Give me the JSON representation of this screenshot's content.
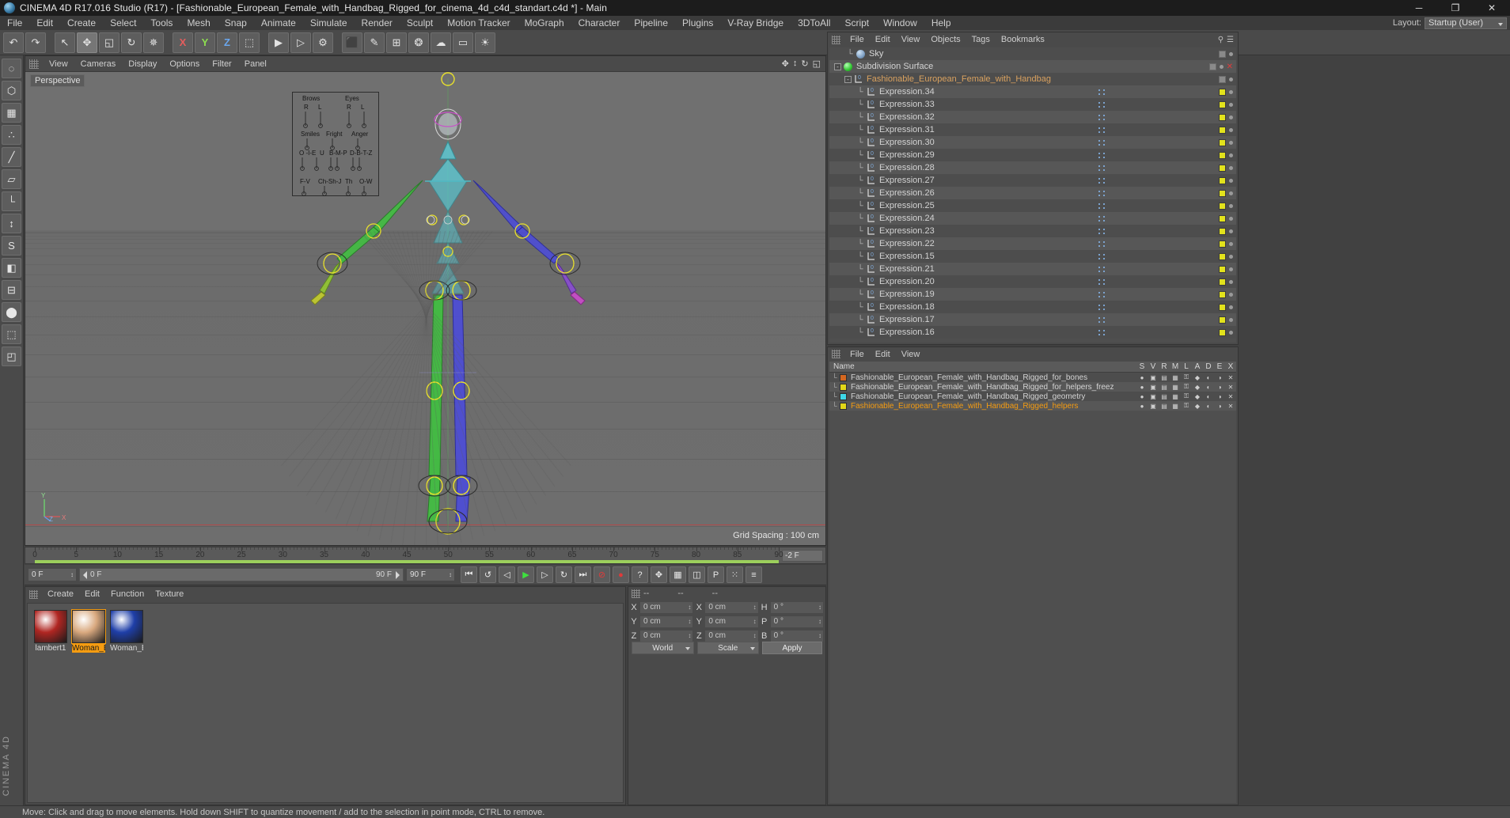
{
  "titlebar": {
    "title": "CINEMA 4D R17.016 Studio (R17) - [Fashionable_European_Female_with_Handbag_Rigged_for_cinema_4d_c4d_standart.c4d *] - Main",
    "icon": "app-icon",
    "minimize": "─",
    "maximize": "❐",
    "close": "✕"
  },
  "menubar": {
    "items": [
      "File",
      "Edit",
      "Create",
      "Select",
      "Tools",
      "Mesh",
      "Snap",
      "Animate",
      "Simulate",
      "Render",
      "Sculpt",
      "Motion Tracker",
      "MoGraph",
      "Character",
      "Pipeline",
      "Plugins",
      "V-Ray Bridge",
      "3DToAll",
      "Script",
      "Window",
      "Help"
    ],
    "layout_label": "Layout:",
    "layout_value": "Startup (User)"
  },
  "toolbar": {
    "buttons": [
      {
        "name": "undo-button",
        "glyph": "↶"
      },
      {
        "name": "redo-button",
        "glyph": "↷"
      },
      {
        "name": "sep1",
        "glyph": ""
      },
      {
        "name": "select-tool-button",
        "glyph": "↖"
      },
      {
        "name": "move-tool-button",
        "glyph": "✥"
      },
      {
        "name": "scale-tool-button",
        "glyph": "◱"
      },
      {
        "name": "rotate-tool-button",
        "glyph": "↻"
      },
      {
        "name": "magnet-tool-button",
        "glyph": "✵"
      },
      {
        "name": "sep2",
        "glyph": ""
      },
      {
        "name": "x-axis-lock-button",
        "glyph": "X"
      },
      {
        "name": "y-axis-lock-button",
        "glyph": "Y"
      },
      {
        "name": "z-axis-lock-button",
        "glyph": "Z"
      },
      {
        "name": "world-coordinate-button",
        "glyph": "⬚"
      },
      {
        "name": "sep3",
        "glyph": ""
      },
      {
        "name": "render-view-button",
        "glyph": "▶"
      },
      {
        "name": "render-region-button",
        "glyph": "▷"
      },
      {
        "name": "render-settings-button",
        "glyph": "⚙"
      },
      {
        "name": "sep4",
        "glyph": ""
      },
      {
        "name": "cube-primitive-button",
        "glyph": "⬛"
      },
      {
        "name": "spline-pen-button",
        "glyph": "✎"
      },
      {
        "name": "array-generator-button",
        "glyph": "⊞"
      },
      {
        "name": "deformer-button",
        "glyph": "❂"
      },
      {
        "name": "environment-button",
        "glyph": "☁"
      },
      {
        "name": "camera-button",
        "glyph": "▭"
      },
      {
        "name": "light-button",
        "glyph": "☀"
      }
    ]
  },
  "left_palette": {
    "buttons": [
      {
        "name": "live-selection-tool",
        "glyph": "◌"
      },
      {
        "name": "model-mode-tool",
        "glyph": "⬡"
      },
      {
        "name": "texture-mode-tool",
        "glyph": "▦"
      },
      {
        "name": "points-mode-tool",
        "glyph": "∴"
      },
      {
        "name": "edges-mode-tool",
        "glyph": "╱"
      },
      {
        "name": "polygons-mode-tool",
        "glyph": "▱"
      },
      {
        "name": "axis-mode-tool",
        "glyph": "└"
      },
      {
        "name": "enable-axis-tool",
        "glyph": "↕"
      },
      {
        "name": "snap-tool",
        "glyph": "S"
      },
      {
        "name": "workplane-tool",
        "glyph": "◧"
      },
      {
        "name": "lock-workplane-tool",
        "glyph": "⊟"
      },
      {
        "name": "viewport-solo-tool",
        "glyph": "⬤"
      },
      {
        "name": "scene-nodes-tool",
        "glyph": "⬚"
      },
      {
        "name": "python-tool",
        "glyph": "◰"
      }
    ],
    "brand": "CINEMA 4D"
  },
  "viewport": {
    "menu": [
      "View",
      "Cameras",
      "Display",
      "Options",
      "Filter",
      "Panel"
    ],
    "camera_label": "Perspective",
    "grid_spacing": "Grid Spacing : 100 cm",
    "corner_icons": [
      "pan-icon",
      "zoom-icon",
      "rotate-icon",
      "maximize-icon"
    ],
    "axis_labels": {
      "y": "Y",
      "x": "X",
      "z": "Z"
    },
    "hud": {
      "col1_title": "Brows",
      "col2_title": "Eyes",
      "col1_sub": [
        "R",
        "L"
      ],
      "col2_sub": [
        "R",
        "L"
      ],
      "row2": [
        "Smiles",
        "Fright",
        "Anger"
      ],
      "row3": [
        "O  -I-E",
        "U",
        "B-M-P",
        "D-B-T-Z"
      ],
      "row4": [
        "F-V",
        "Ch-Sh-J",
        "Th",
        "O-W"
      ]
    }
  },
  "timeline": {
    "ticks": [
      "0",
      "5",
      "10",
      "15",
      "20",
      "25",
      "30",
      "35",
      "40",
      "45",
      "50",
      "55",
      "60",
      "65",
      "70",
      "75",
      "80",
      "85",
      "90"
    ],
    "current_frame_field": "-2 F"
  },
  "transport": {
    "current_frame": "0 F",
    "range_start": "0 F",
    "range_end": "90 F",
    "end_frame_field": "90 F",
    "buttons": [
      {
        "name": "go-to-start-button",
        "glyph": "⏮"
      },
      {
        "name": "previous-key-button",
        "glyph": "↺"
      },
      {
        "name": "step-back-button",
        "glyph": "◁"
      },
      {
        "name": "play-button",
        "glyph": "▶"
      },
      {
        "name": "step-forward-button",
        "glyph": "▷"
      },
      {
        "name": "next-key-button",
        "glyph": "↻"
      },
      {
        "name": "go-to-end-button",
        "glyph": "⏭"
      },
      {
        "name": "record-active-objects-button",
        "glyph": "⊘"
      },
      {
        "name": "autokeying-button",
        "glyph": "●"
      },
      {
        "name": "keyframe-selection-button",
        "glyph": "?"
      },
      {
        "name": "position-key-button",
        "glyph": "✥"
      },
      {
        "name": "rotation-key-button",
        "glyph": "▦"
      },
      {
        "name": "scale-key-button",
        "glyph": "◫"
      },
      {
        "name": "parameter-key-button",
        "glyph": "P"
      },
      {
        "name": "point-level-animation-button",
        "glyph": "⁙"
      },
      {
        "name": "timeline-settings-button",
        "glyph": "≡"
      }
    ]
  },
  "material_manager": {
    "menu": [
      "Create",
      "Edit",
      "Function",
      "Texture"
    ],
    "materials": [
      {
        "name": "lambert1",
        "color": "#b02622",
        "selected": false
      },
      {
        "name": "Woman_Body",
        "color": "#d9a97f",
        "selected": true
      },
      {
        "name": "Woman_Bag",
        "color": "#1f3fa8",
        "selected": false
      }
    ]
  },
  "coordinate_manager": {
    "header_dash": "--",
    "col_dash_2": "--",
    "col_dash_3": "--",
    "rows": [
      {
        "axis": "X",
        "pos": "0 cm",
        "size": "0 cm",
        "rot_label": "H",
        "rot": "0 °"
      },
      {
        "axis": "Y",
        "pos": "0 cm",
        "size": "0 cm",
        "rot_label": "P",
        "rot": "0 °"
      },
      {
        "axis": "Z",
        "pos": "0 cm",
        "size": "0 cm",
        "rot_label": "B",
        "rot": "0 °"
      }
    ],
    "coord_system": "World",
    "size_mode": "Scale",
    "apply_label": "Apply"
  },
  "object_manager": {
    "menu": [
      "File",
      "Edit",
      "View",
      "Objects",
      "Tags",
      "Bookmarks"
    ],
    "right_icons": [
      "search-icon",
      "filter-icon"
    ],
    "rows": [
      {
        "label": "Sky",
        "indent": 1,
        "icon": "sky-sphere-icon",
        "expander": "",
        "tag": "none",
        "vis": true
      },
      {
        "label": "Subdivision Surface",
        "indent": 0,
        "icon": "subdivision-surface-icon",
        "expander": "-",
        "tag": "none",
        "vis": true,
        "close": true
      },
      {
        "label": "Fashionable_European_Female_with_Handbag",
        "indent": 1,
        "icon": "expression-tag-icon",
        "expander": "-",
        "tag": "none",
        "vis": false
      },
      {
        "label": "Expression.34",
        "indent": 2,
        "icon": "expression-tag-icon",
        "expander": "",
        "tag": "yellow",
        "vis": true,
        "dots": true
      },
      {
        "label": "Expression.33",
        "indent": 2,
        "icon": "expression-tag-icon",
        "expander": "",
        "tag": "yellow",
        "vis": true,
        "dots": true
      },
      {
        "label": "Expression.32",
        "indent": 2,
        "icon": "expression-tag-icon",
        "expander": "",
        "tag": "yellow",
        "vis": true,
        "dots": true
      },
      {
        "label": "Expression.31",
        "indent": 2,
        "icon": "expression-tag-icon",
        "expander": "",
        "tag": "yellow",
        "vis": true,
        "dots": true
      },
      {
        "label": "Expression.30",
        "indent": 2,
        "icon": "expression-tag-icon",
        "expander": "",
        "tag": "yellow",
        "vis": true,
        "dots": true
      },
      {
        "label": "Expression.29",
        "indent": 2,
        "icon": "expression-tag-icon",
        "expander": "",
        "tag": "yellow",
        "vis": true,
        "dots": true
      },
      {
        "label": "Expression.28",
        "indent": 2,
        "icon": "expression-tag-icon",
        "expander": "",
        "tag": "yellow",
        "vis": true,
        "dots": true
      },
      {
        "label": "Expression.27",
        "indent": 2,
        "icon": "expression-tag-icon",
        "expander": "",
        "tag": "yellow",
        "vis": true,
        "dots": true
      },
      {
        "label": "Expression.26",
        "indent": 2,
        "icon": "expression-tag-icon",
        "expander": "",
        "tag": "yellow",
        "vis": true,
        "dots": true
      },
      {
        "label": "Expression.25",
        "indent": 2,
        "icon": "expression-tag-icon",
        "expander": "",
        "tag": "yellow",
        "vis": true,
        "dots": true
      },
      {
        "label": "Expression.24",
        "indent": 2,
        "icon": "expression-tag-icon",
        "expander": "",
        "tag": "yellow",
        "vis": true,
        "dots": true
      },
      {
        "label": "Expression.23",
        "indent": 2,
        "icon": "expression-tag-icon",
        "expander": "",
        "tag": "yellow",
        "vis": true,
        "dots": true
      },
      {
        "label": "Expression.22",
        "indent": 2,
        "icon": "expression-tag-icon",
        "expander": "",
        "tag": "yellow",
        "vis": true,
        "dots": true
      },
      {
        "label": "Expression.15",
        "indent": 2,
        "icon": "expression-tag-icon",
        "expander": "",
        "tag": "yellow",
        "vis": true,
        "dots": true
      },
      {
        "label": "Expression.21",
        "indent": 2,
        "icon": "expression-tag-icon",
        "expander": "",
        "tag": "yellow",
        "vis": true,
        "dots": true
      },
      {
        "label": "Expression.20",
        "indent": 2,
        "icon": "expression-tag-icon",
        "expander": "",
        "tag": "yellow",
        "vis": true,
        "dots": true
      },
      {
        "label": "Expression.19",
        "indent": 2,
        "icon": "expression-tag-icon",
        "expander": "",
        "tag": "yellow",
        "vis": true,
        "dots": true
      },
      {
        "label": "Expression.18",
        "indent": 2,
        "icon": "expression-tag-icon",
        "expander": "",
        "tag": "yellow",
        "vis": true,
        "dots": true
      },
      {
        "label": "Expression.17",
        "indent": 2,
        "icon": "expression-tag-icon",
        "expander": "",
        "tag": "yellow",
        "vis": true,
        "dots": true
      },
      {
        "label": "Expression.16",
        "indent": 2,
        "icon": "expression-tag-icon",
        "expander": "",
        "tag": "yellow",
        "vis": true,
        "dots": true
      }
    ]
  },
  "layer_manager": {
    "menu": [
      "File",
      "Edit",
      "View"
    ],
    "name_col": "Name",
    "columns": [
      "S",
      "V",
      "R",
      "M",
      "L",
      "A",
      "D",
      "E",
      "X"
    ],
    "rows": [
      {
        "label": "Fashionable_European_Female_with_Handbag_Rigged_for_bones",
        "color": "#d4671f",
        "selected": false
      },
      {
        "label": "Fashionable_European_Female_with_Handbag_Rigged_for_helpers_freez",
        "color": "#e2d718",
        "selected": false
      },
      {
        "label": "Fashionable_European_Female_with_Handbag_Rigged_geometry",
        "color": "#3ed8e8",
        "selected": false
      },
      {
        "label": "Fashionable_European_Female_with_Handbag_Rigged_helpers",
        "color": "#e2d718",
        "selected": true
      }
    ]
  },
  "statusbar": {
    "message": "Move: Click and drag to move elements. Hold down SHIFT to quantize movement / add to the selection in point mode, CTRL to remove."
  }
}
